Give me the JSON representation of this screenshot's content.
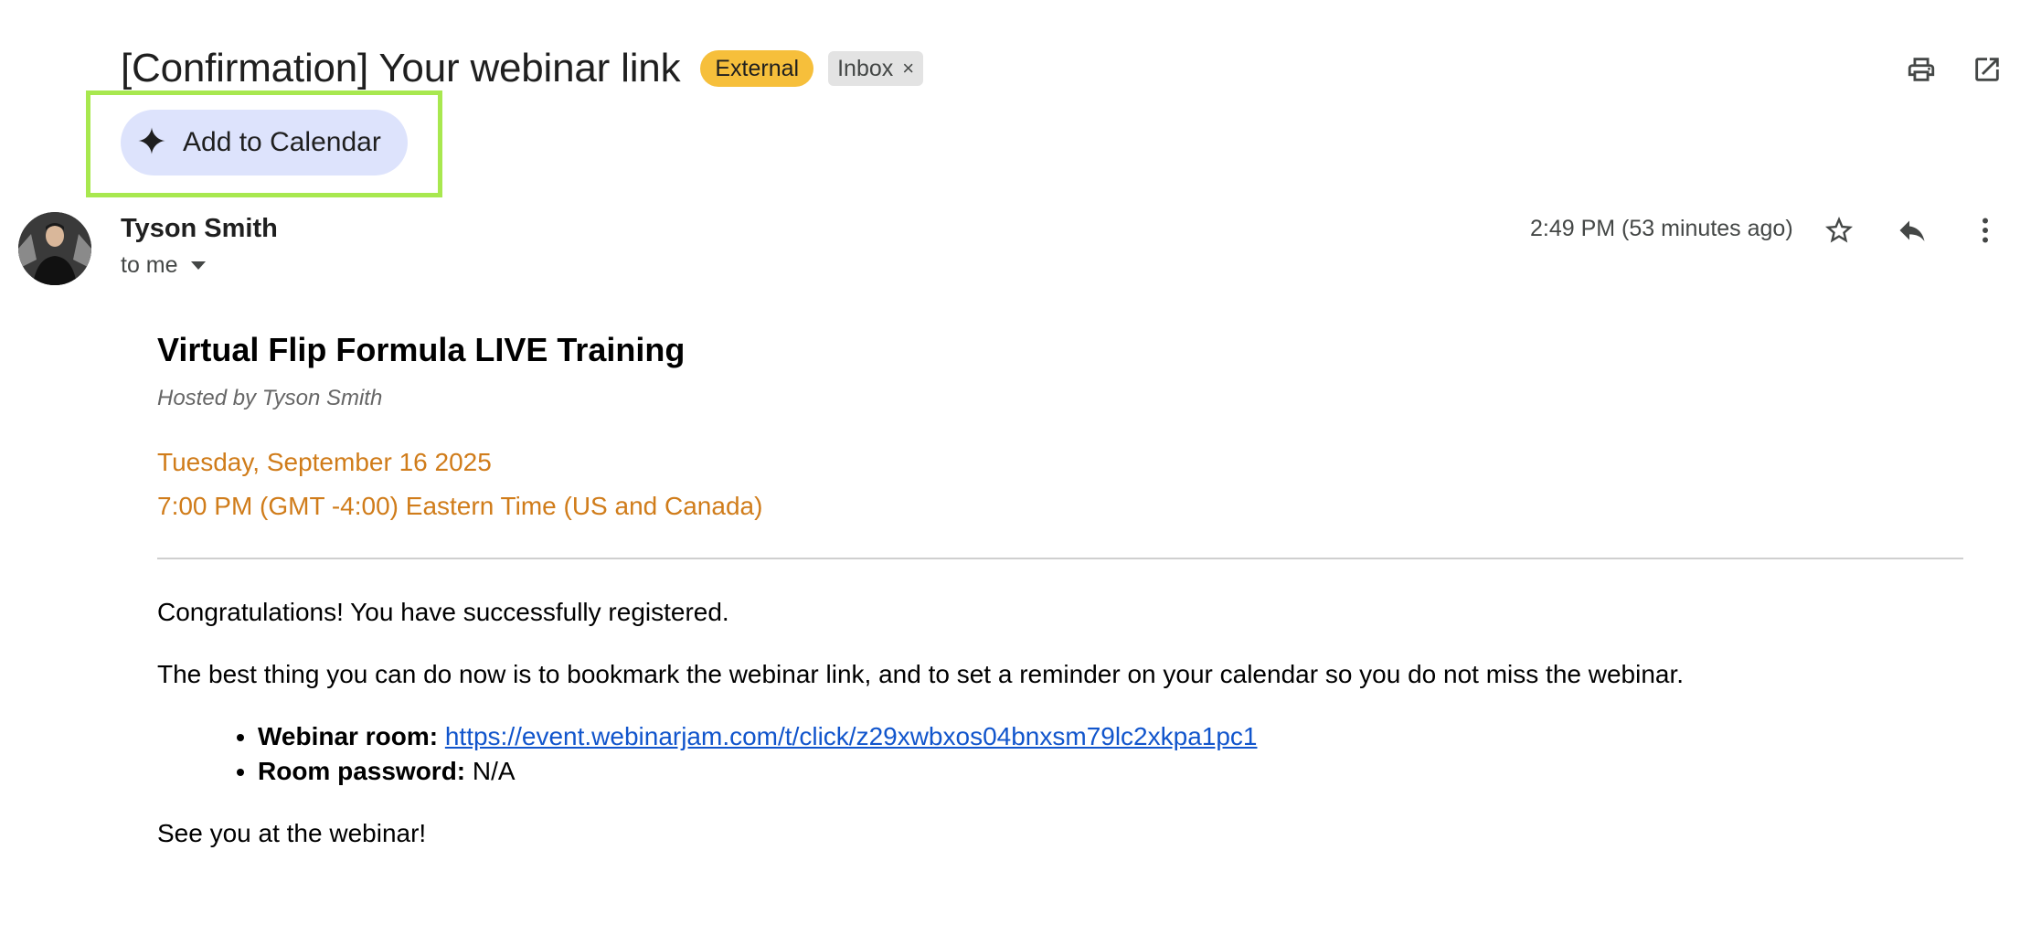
{
  "email": {
    "subject": "[Confirmation] Your webinar link",
    "labels": {
      "external": "External",
      "inbox": "Inbox",
      "inbox_remove": "×"
    },
    "add_to_calendar": "Add to Calendar",
    "sender_name": "Tyson Smith",
    "recipient": "to me",
    "time": "2:49 PM (53 minutes ago)"
  },
  "icons": {
    "print": "print-icon",
    "open_new_window": "open-in-new-window-icon",
    "sparkle": "sparkle-icon",
    "star": "star-icon",
    "reply": "reply-icon",
    "more": "more-vertical-icon"
  },
  "message": {
    "title": "Virtual Flip Formula LIVE Training",
    "hosted_by": "Hosted by Tyson Smith",
    "date": "Tuesday, September 16 2025",
    "time": "7:00 PM (GMT -4:00) Eastern Time (US and Canada)",
    "congrats": "Congratulations! You have successfully registered.",
    "advice": "The best thing you can do now is to bookmark the webinar link, and to set a reminder on your calendar so you do not miss the webinar.",
    "room_label": "Webinar room:",
    "room_url": "https://event.webinarjam.com/t/click/z29xwbxos04bnxsm79lc2xkpa1pc1",
    "password_label": "Room password:",
    "password_value": "N/A",
    "signoff": "See you at the webinar!"
  },
  "colors": {
    "highlight_border": "#a8e84f",
    "calendar_button_bg": "#dde3fc",
    "external_badge": "#f6bf3b",
    "date_orange": "#d07c1a",
    "link_blue": "#1155cc"
  }
}
